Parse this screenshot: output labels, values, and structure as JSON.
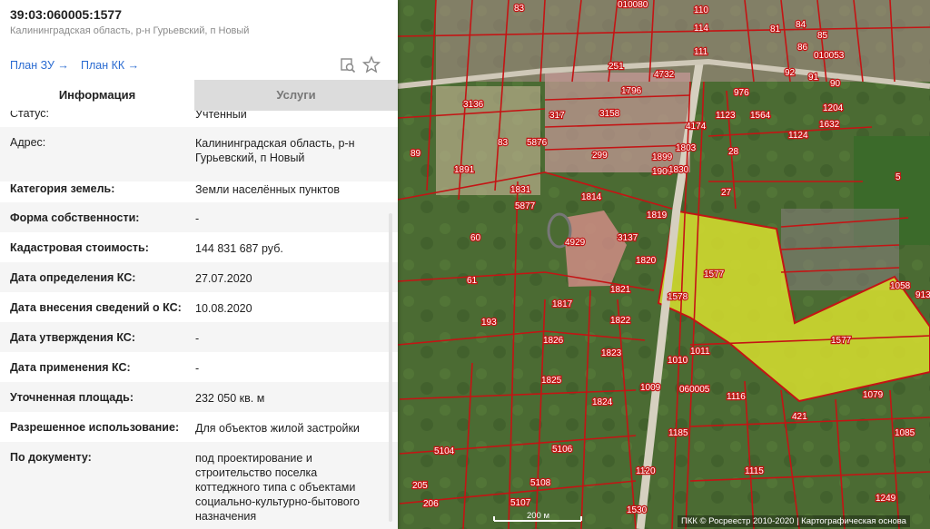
{
  "header": {
    "cadastral_number": "39:03:060005:1577",
    "address": "Калининградская область, р-н Гурьевский, п Новый"
  },
  "links": [
    {
      "label": "План ЗУ →"
    },
    {
      "label": "План КК →"
    }
  ],
  "icons": [
    "search-document-icon",
    "star-icon"
  ],
  "tabs": {
    "info": "Информация",
    "services": "Услуги"
  },
  "rows": [
    {
      "label": "Статус:",
      "value": "Учтенный"
    },
    {
      "label": "Адрес:",
      "value": "Калининградская область, р-н Гурьевский, п Новый"
    },
    {
      "label": "Категория земель:",
      "value": "Земли населённых пунктов"
    },
    {
      "label": "Форма собственности:",
      "value": "-"
    },
    {
      "label": "Кадастровая стоимость:",
      "value": "144 831 687 руб."
    },
    {
      "label": "Дата определения КС:",
      "value": "27.07.2020"
    },
    {
      "label": "Дата внесения сведений о КС:",
      "value": "10.08.2020"
    },
    {
      "label": "Дата утверждения КС:",
      "value": "-"
    },
    {
      "label": "Дата применения КС:",
      "value": "-"
    },
    {
      "label": "Уточненная площадь:",
      "value": "232 050 кв. м"
    },
    {
      "label": "Разрешенное использование:",
      "value": "Для объектов жилой застройки"
    },
    {
      "label": "По документу:",
      "value": "под проектирование и строительство поселка коттеджного типа с объектами социально-культурно-бытового назначения"
    }
  ],
  "map": {
    "parcel_labels": [
      "1577",
      "1577",
      "1578",
      "060005",
      "010080",
      "010053",
      "4929",
      "1814",
      "1817",
      "1821",
      "1822",
      "1823",
      "1824",
      "1825",
      "1826",
      "1820",
      "1819",
      "3137",
      "3158",
      "1796",
      "4732",
      "976",
      "1123",
      "1564",
      "1204",
      "1124",
      "1632",
      "28",
      "27",
      "5",
      "60",
      "61",
      "193",
      "89",
      "83",
      "3136",
      "1891",
      "1831",
      "5877",
      "5876",
      "317",
      "299",
      "1899",
      "1900",
      "1830",
      "1803",
      "4174",
      "1010",
      "1009",
      "1011",
      "1116",
      "421",
      "1079",
      "1085",
      "1185",
      "1120",
      "1115",
      "1530",
      "1249",
      "5104",
      "5106",
      "5108",
      "5107",
      "205",
      "206",
      "251",
      "110",
      "114",
      "111",
      "85",
      "86",
      "81",
      "92",
      "91",
      "90",
      "84",
      "83",
      "1058",
      "913"
    ],
    "scale_label": "200 м",
    "attribution": "ПКК © Росреестр 2010-2020 | Картографическая основа"
  },
  "colors": {
    "parcel_line": "#c41414",
    "highlight_fill": "#d7df2f",
    "link": "#2a6bd1"
  }
}
